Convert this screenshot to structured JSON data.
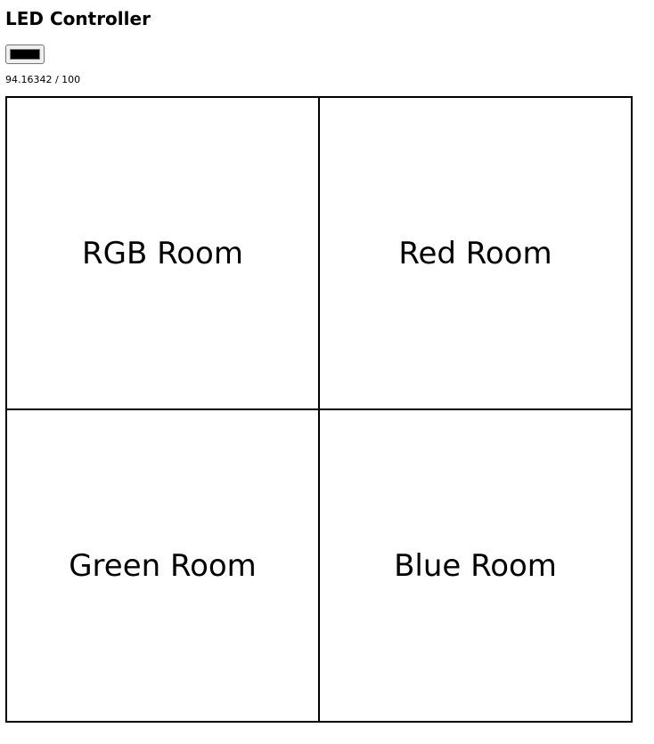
{
  "header": {
    "title": "LED Controller"
  },
  "controls": {
    "selected_color": "#000000",
    "brightness_readout": "94.16342 / 100"
  },
  "rooms": [
    {
      "label": "RGB Room"
    },
    {
      "label": "Red Room"
    },
    {
      "label": "Green Room"
    },
    {
      "label": "Blue Room"
    }
  ]
}
